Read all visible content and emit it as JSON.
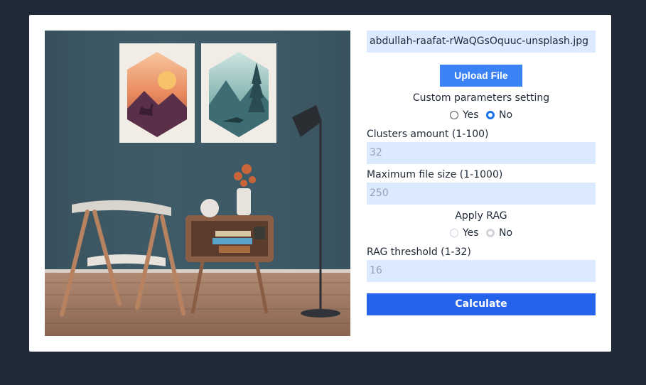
{
  "file": {
    "name": "abdullah-raafat-rWaQGsOquuc-unsplash.jpg",
    "upload_label": "Upload File"
  },
  "custom_params": {
    "title": "Custom parameters setting",
    "yes_label": "Yes",
    "no_label": "No",
    "selected": "No"
  },
  "clusters": {
    "label": "Clusters amount (1-100)",
    "value": "32"
  },
  "max_file_size": {
    "label": "Maximum file size (1-1000)",
    "value": "250"
  },
  "rag": {
    "title": "Apply RAG",
    "yes_label": "Yes",
    "no_label": "No",
    "selected": "No",
    "disabled": true
  },
  "rag_threshold": {
    "label": "RAG threshold (1-32)",
    "value": "16"
  },
  "calculate_label": "Calculate",
  "colors": {
    "background": "#1f2937",
    "field_bg": "#dbeafe",
    "upload_button": "#3b82f6",
    "calculate_button": "#2563eb",
    "radio_checked": "#1a73e8"
  }
}
